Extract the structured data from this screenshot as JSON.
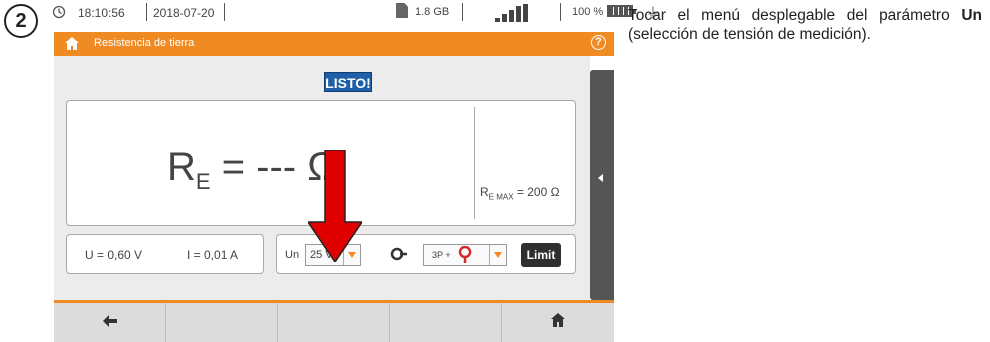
{
  "step": "2",
  "status_bar": {
    "time": "18:10:56",
    "date": "2018-07-20",
    "storage": "1.8 GB",
    "battery_percent": "100 %",
    "icons": [
      "clock-icon",
      "sd-card-icon",
      "signal-icon",
      "battery-icon",
      "plug-icon"
    ]
  },
  "title_bar": {
    "title": "Resistencia de tierra",
    "help": "?"
  },
  "status_badge": "LISTO!",
  "result": {
    "symbol": "R",
    "subscript": "E",
    "value_text": " = --- Ω",
    "limit_symbol": "R",
    "limit_subscript": "E MAX",
    "limit_value": " = 200 Ω"
  },
  "measurements": {
    "u": "U = 0,60 V",
    "i": "I = 0,01 A"
  },
  "controls": {
    "un_label": "Un",
    "un_value": "25 V",
    "mode_value": "3P +",
    "limit_label": "Limit"
  },
  "nav": {
    "items": [
      "back-icon",
      "",
      "",
      "",
      "home-icon"
    ]
  },
  "instruction": {
    "part1": "Tocar el menú desplegable del parámetro ",
    "bold": "Un",
    "part2": " (selección de tensión de medición)."
  },
  "colors": {
    "accent": "#f08a23",
    "badge": "#1f5fa8",
    "arrow": "#e00000"
  }
}
